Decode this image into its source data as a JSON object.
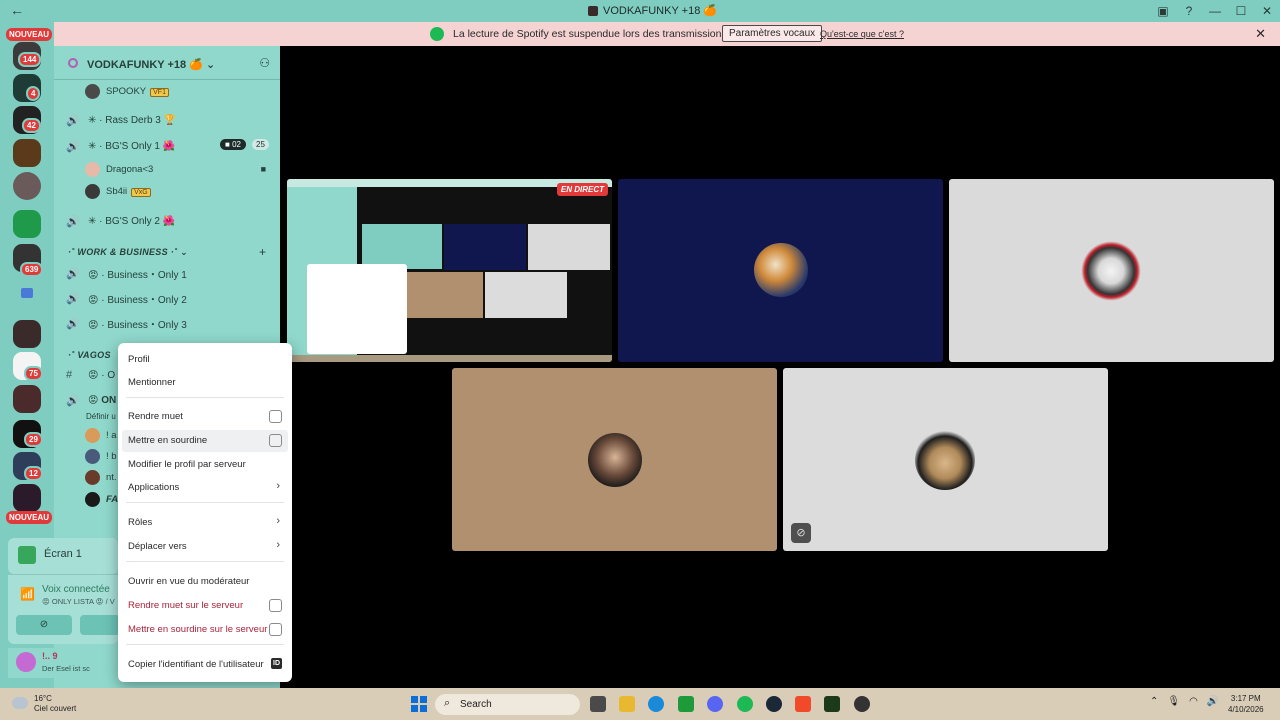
{
  "window": {
    "title": "VODKAFUNKY +18 🍊",
    "back_glyph": "←",
    "buttons": [
      "▣",
      "?",
      "—",
      "☐",
      "✕"
    ]
  },
  "notice": {
    "text": "La lecture de Spotify est suspendue lors des transmissions audio.",
    "button_label": "Paramètres vocaux",
    "link_label": "Qu'est-ce que c'est ?",
    "close": "✕"
  },
  "rail": {
    "new_label_top": "NOUVEAU",
    "new_label_bottom": "NOUVEAU",
    "badges": [
      "144",
      "4",
      "42",
      "639",
      "75",
      "29",
      "12"
    ]
  },
  "server": {
    "name": "VODKAFUNKY +18 🍊",
    "chevron": "⌄"
  },
  "channels": {
    "spooky_user": "SPOOKY",
    "spooky_tag": "VF1",
    "rass": "Rass Derb 3 🏆",
    "bgs1": "BG'S Only 1 🌺",
    "bgs1_cam": "02",
    "bgs1_count": "25",
    "dragona": "Dragona<3",
    "sb4ii": "Sb4ii",
    "sb4ii_tag": "VxG",
    "bgs2": "BG'S Only 2 🌺",
    "cat_work": "WORK & BUSINESS",
    "biz1": "Business・Only 1",
    "biz2": "Business・Only 2",
    "biz3": "Business・Only 3",
    "cat_vagos": "VAGOS",
    "hash_row": "O",
    "only_row": "ON",
    "definir": "Définir u",
    "u1": "! a",
    "u2": "! b",
    "u3": "nt.",
    "u4": "FA"
  },
  "bottom": {
    "screen_label": "Écran 1",
    "voice_title": "Voix connectée",
    "voice_sub": "😡 ONLY LISTA 😡 / V",
    "user_name": "!.. 9",
    "user_status": "Der Esel ist sc"
  },
  "stream": {
    "live_label": "EN DIRECT"
  },
  "menu": {
    "profil": "Profil",
    "mentionner": "Mentionner",
    "rendre_muet": "Rendre muet",
    "sourdine": "Mettre en sourdine",
    "modifier_profil": "Modifier le profil par serveur",
    "applications": "Applications",
    "roles": "Rôles",
    "deplacer": "Déplacer vers",
    "moderateur": "Ouvrir en vue du modérateur",
    "muet_serveur": "Rendre muet sur le serveur",
    "sourdine_serveur": "Mettre en sourdine sur le serveur",
    "copier_id": "Copier l'identifiant de l'utilisateur",
    "id_badge": "ID",
    "arrow": "›"
  },
  "taskbar": {
    "temp": "16°C",
    "weather": "Ciel couvert",
    "search": "Search",
    "time": "3:17 PM",
    "date": "4/10/2026"
  },
  "colors": {
    "rail_bg": "#7fcdc0",
    "sidebar_bg": "#8fd8cb",
    "notice_bg": "#f6d3d3",
    "spotify": "#1db954",
    "danger": "#a8243a"
  }
}
